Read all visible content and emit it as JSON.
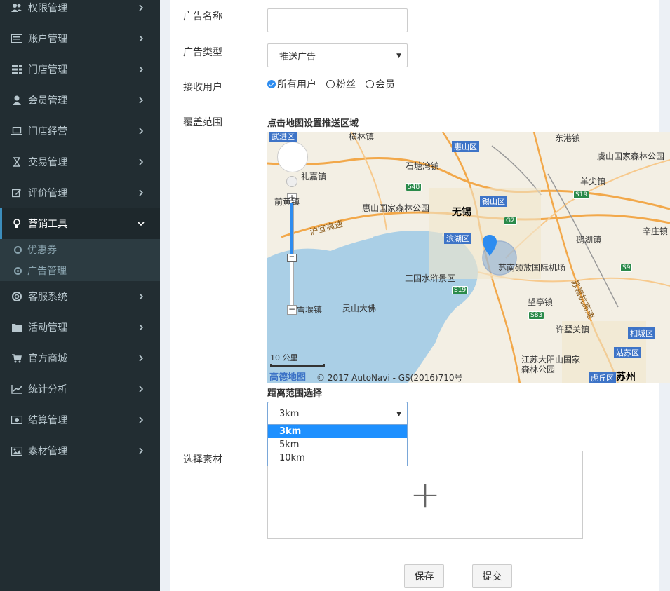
{
  "sidebar": {
    "items": [
      {
        "label": "权限管理",
        "icon": "users-icon"
      },
      {
        "label": "账户管理",
        "icon": "id-card-icon"
      },
      {
        "label": "门店管理",
        "icon": "grid-icon"
      },
      {
        "label": "会员管理",
        "icon": "user-icon"
      },
      {
        "label": "门店经营",
        "icon": "laptop-icon"
      },
      {
        "label": "交易管理",
        "icon": "hourglass-icon"
      },
      {
        "label": "评价管理",
        "icon": "edit-icon"
      },
      {
        "label": "营销工具",
        "icon": "lightbulb-icon"
      },
      {
        "label": "客服系统",
        "icon": "lifebuoy-icon"
      },
      {
        "label": "活动管理",
        "icon": "folder-icon"
      },
      {
        "label": "官方商城",
        "icon": "cart-icon"
      },
      {
        "label": "统计分析",
        "icon": "line-chart-icon"
      },
      {
        "label": "结算管理",
        "icon": "money-icon"
      },
      {
        "label": "素材管理",
        "icon": "image-icon"
      }
    ],
    "sub_items": [
      {
        "label": "优惠券"
      },
      {
        "label": "广告管理"
      }
    ]
  },
  "form": {
    "name_label": "广告名称",
    "name_value": "",
    "type_label": "广告类型",
    "type_value": "推送广告",
    "receiver_label": "接收用户",
    "receivers": [
      "所有用户",
      "粉丝",
      "会员"
    ],
    "coverage_label": "覆盖范围",
    "map_hint": "点击地图设置推送区域",
    "distance_label": "距离范围选择",
    "distance_value": "3km",
    "distance_options": [
      "3km",
      "5km",
      "10km"
    ],
    "material_label": "选择素材",
    "save_label": "保存",
    "submit_label": "提交"
  },
  "map": {
    "labels": [
      "武进区",
      "横林镇",
      "惠山区",
      "东港镇",
      "虞山国家森林公园",
      "礼嘉镇",
      "石塘湾镇",
      "羊尖镇",
      "前黄镇",
      "锡山区",
      "惠山国家森林公园",
      "无锡",
      "辛庄镇",
      "沪宜高速",
      "滨湖区",
      "鹅湖镇",
      "苏南硕放国际机场",
      "三国水浒景区",
      "灵山大佛",
      "望亭镇",
      "苏嘉杭高速",
      "许墅关镇",
      "相城区",
      "江苏大阳山国家森林公园",
      "姑苏区",
      "虎丘区",
      "苏州",
      "雪堰镇"
    ],
    "shields": [
      "S48",
      "G2",
      "S19",
      "S9",
      "S83"
    ],
    "scale": "10 公里",
    "logo": "高德地图",
    "copyright": "© 2017 AutoNavi - GS(2016)710号"
  }
}
